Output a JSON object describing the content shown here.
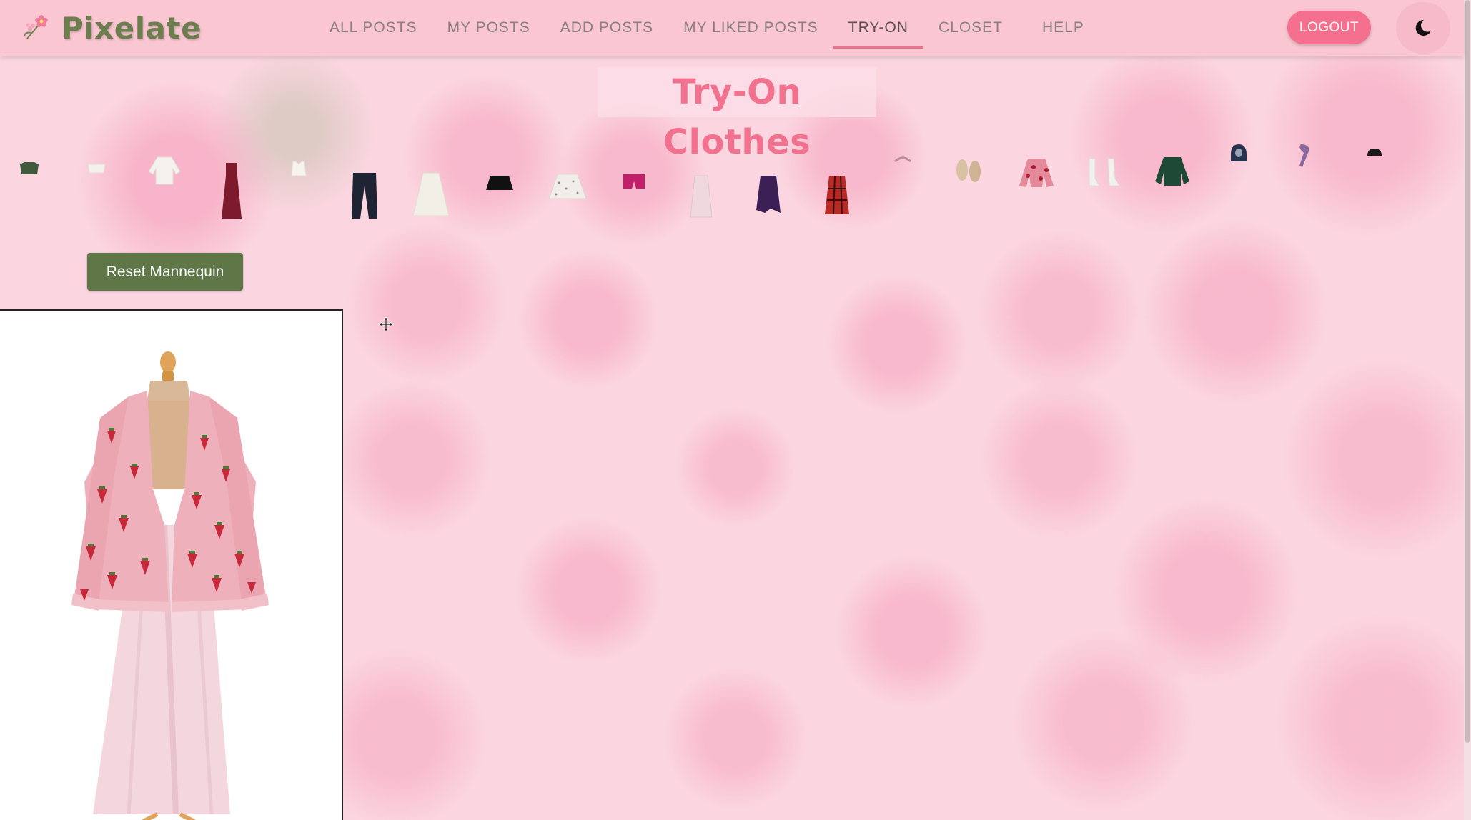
{
  "brand": {
    "name": "Pixelate",
    "logo_icon": "flower-icon"
  },
  "nav": {
    "items": [
      {
        "label": "ALL POSTS",
        "active": false
      },
      {
        "label": "MY POSTS",
        "active": false
      },
      {
        "label": "ADD POSTS",
        "active": false
      },
      {
        "label": "MY LIKED POSTS",
        "active": false
      },
      {
        "label": "TRY-ON",
        "active": true
      },
      {
        "label": "CLOSET",
        "active": false
      },
      {
        "label": "HELP",
        "active": false
      }
    ],
    "logout_label": "LOGOUT",
    "theme_toggle_icon": "moon-icon"
  },
  "page": {
    "title": "Try-On Clothes",
    "reset_label": "Reset Mannequin"
  },
  "clothing_items": [
    {
      "name": "green-crop-top",
      "color": "#3f5a3c"
    },
    {
      "name": "white-top",
      "color": "#f3efe9"
    },
    {
      "name": "white-blouse",
      "color": "#f5f2ee"
    },
    {
      "name": "burgundy-dress",
      "color": "#7d1a2c"
    },
    {
      "name": "white-tank-top",
      "color": "#f7f4f0"
    },
    {
      "name": "black-jeans",
      "color": "#1e2433"
    },
    {
      "name": "white-maxi-skirt",
      "color": "#f2efe6"
    },
    {
      "name": "black-mini-skirt",
      "color": "#111111"
    },
    {
      "name": "floral-skirt",
      "color": "#f1eeea"
    },
    {
      "name": "magenta-shorts",
      "color": "#c0206a"
    },
    {
      "name": "pink-satin-skirt",
      "color": "#f0d8df"
    },
    {
      "name": "purple-tiered-skirt",
      "color": "#3c1f55"
    },
    {
      "name": "red-plaid-skirt",
      "color": "#b82a26"
    },
    {
      "name": "pink-hair-clip",
      "color": "#d6a8b4"
    },
    {
      "name": "beige-shoes",
      "color": "#d9c1a3"
    },
    {
      "name": "strawberry-cardigan",
      "color": "#e48a9a"
    },
    {
      "name": "white-boots",
      "color": "#f3f1ee"
    },
    {
      "name": "green-sweater",
      "color": "#1e4a35"
    },
    {
      "name": "navy-hoodie",
      "color": "#27324e"
    },
    {
      "name": "purple-scarf",
      "color": "#8a6a9a"
    },
    {
      "name": "black-beanie",
      "color": "#1a1a1a"
    }
  ],
  "mannequin": {
    "top": "strawberry-cardigan",
    "bottom": "pink-satin-skirt",
    "colors": {
      "cardigan": "#eeb0bb",
      "strawberry": "#c8283a",
      "skirt": "#f3d6de",
      "stand": "#e0a35a"
    }
  },
  "colors": {
    "navbar": "#f9c6d2",
    "accent": "#f2718f",
    "brand": "#6c7d4e",
    "reset_button": "#5f7746"
  }
}
